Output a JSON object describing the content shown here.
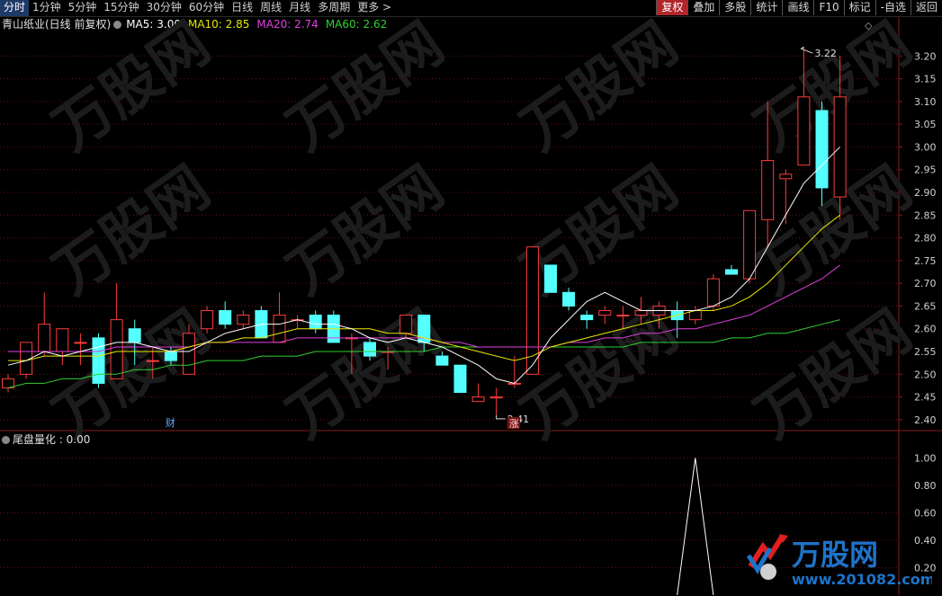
{
  "toolbar": {
    "left": [
      "分时",
      "1分钟",
      "5分钟",
      "15分钟",
      "30分钟",
      "60分钟",
      "日线",
      "周线",
      "月线",
      "多周期",
      "更多 >"
    ],
    "right": [
      "复权",
      "叠加",
      "多股",
      "统计",
      "画线",
      "F10",
      "标记",
      "-自选",
      "返回"
    ],
    "active_left": 0,
    "active_right": 0
  },
  "info": {
    "stock": "青山纸业(日线 前复权)",
    "ma5": "MA5: 3.00",
    "ma10": "MA10: 2.85",
    "ma20": "MA20: 2.74",
    "ma60": "MA60: 2.62"
  },
  "subchart": {
    "label": "尾盘量化 : 0.00"
  },
  "watermark": {
    "brand": "万股网",
    "url": "www.201082.com"
  },
  "colors": {
    "up": "#ff3c3c",
    "down": "#54ffff",
    "ma5": "#ffffff",
    "ma10": "#e8e800",
    "ma20": "#e040e0",
    "ma60": "#30d030",
    "grid": "#6a1010",
    "axis_text": "#d0d0d0",
    "indicator": "#ffffff"
  },
  "chart_data": {
    "type": "candlestick",
    "title": "",
    "y_ticks": [
      2.4,
      2.45,
      2.5,
      2.55,
      2.6,
      2.65,
      2.7,
      2.75,
      2.8,
      2.85,
      2.9,
      2.95,
      3.0,
      3.05,
      3.1,
      3.15,
      3.2
    ],
    "ylim": [
      2.38,
      3.25
    ],
    "annotations": {
      "high": "3.22",
      "low": "2.41",
      "marker_cai": "财",
      "marker_zhang": "涨"
    },
    "candles": [
      {
        "o": 2.47,
        "h": 2.5,
        "l": 2.46,
        "c": 2.49
      },
      {
        "o": 2.5,
        "h": 2.57,
        "l": 2.49,
        "c": 2.57
      },
      {
        "o": 2.55,
        "h": 2.68,
        "l": 2.54,
        "c": 2.61
      },
      {
        "o": 2.55,
        "h": 2.6,
        "l": 2.52,
        "c": 2.6
      },
      {
        "o": 2.57,
        "h": 2.59,
        "l": 2.52,
        "c": 2.57
      },
      {
        "o": 2.58,
        "h": 2.59,
        "l": 2.47,
        "c": 2.48
      },
      {
        "o": 2.49,
        "h": 2.7,
        "l": 2.49,
        "c": 2.62
      },
      {
        "o": 2.6,
        "h": 2.62,
        "l": 2.52,
        "c": 2.57
      },
      {
        "o": 2.53,
        "h": 2.56,
        "l": 2.49,
        "c": 2.53
      },
      {
        "o": 2.55,
        "h": 2.56,
        "l": 2.52,
        "c": 2.53
      },
      {
        "o": 2.5,
        "h": 2.61,
        "l": 2.5,
        "c": 2.59
      },
      {
        "o": 2.6,
        "h": 2.65,
        "l": 2.59,
        "c": 2.64
      },
      {
        "o": 2.64,
        "h": 2.66,
        "l": 2.6,
        "c": 2.61
      },
      {
        "o": 2.61,
        "h": 2.64,
        "l": 2.6,
        "c": 2.63
      },
      {
        "o": 2.64,
        "h": 2.65,
        "l": 2.59,
        "c": 2.58
      },
      {
        "o": 2.57,
        "h": 2.68,
        "l": 2.57,
        "c": 2.63
      },
      {
        "o": 2.62,
        "h": 2.63,
        "l": 2.6,
        "c": 2.62
      },
      {
        "o": 2.63,
        "h": 2.64,
        "l": 2.59,
        "c": 2.6
      },
      {
        "o": 2.63,
        "h": 2.64,
        "l": 2.57,
        "c": 2.57
      },
      {
        "o": 2.58,
        "h": 2.59,
        "l": 2.5,
        "c": 2.58
      },
      {
        "o": 2.57,
        "h": 2.58,
        "l": 2.53,
        "c": 2.54
      },
      {
        "o": 2.55,
        "h": 2.56,
        "l": 2.51,
        "c": 2.55
      },
      {
        "o": 2.59,
        "h": 2.63,
        "l": 2.58,
        "c": 2.63
      },
      {
        "o": 2.63,
        "h": 2.63,
        "l": 2.55,
        "c": 2.57
      },
      {
        "o": 2.54,
        "h": 2.55,
        "l": 2.52,
        "c": 2.52
      },
      {
        "o": 2.52,
        "h": 2.52,
        "l": 2.46,
        "c": 2.46
      },
      {
        "o": 2.44,
        "h": 2.48,
        "l": 2.44,
        "c": 2.45
      },
      {
        "o": 2.45,
        "h": 2.47,
        "l": 2.41,
        "c": 2.45
      },
      {
        "o": 2.48,
        "h": 2.54,
        "l": 2.47,
        "c": 2.48
      },
      {
        "o": 2.5,
        "h": 2.78,
        "l": 2.5,
        "c": 2.78
      },
      {
        "o": 2.74,
        "h": 2.74,
        "l": 2.68,
        "c": 2.68
      },
      {
        "o": 2.68,
        "h": 2.69,
        "l": 2.64,
        "c": 2.65
      },
      {
        "o": 2.63,
        "h": 2.64,
        "l": 2.6,
        "c": 2.62
      },
      {
        "o": 2.63,
        "h": 2.65,
        "l": 2.61,
        "c": 2.64
      },
      {
        "o": 2.63,
        "h": 2.65,
        "l": 2.6,
        "c": 2.63
      },
      {
        "o": 2.63,
        "h": 2.67,
        "l": 2.61,
        "c": 2.64
      },
      {
        "o": 2.63,
        "h": 2.66,
        "l": 2.6,
        "c": 2.65
      },
      {
        "o": 2.64,
        "h": 2.66,
        "l": 2.58,
        "c": 2.62
      },
      {
        "o": 2.62,
        "h": 2.65,
        "l": 2.61,
        "c": 2.64
      },
      {
        "o": 2.65,
        "h": 2.72,
        "l": 2.64,
        "c": 2.71
      },
      {
        "o": 2.73,
        "h": 2.74,
        "l": 2.72,
        "c": 2.72
      },
      {
        "o": 2.71,
        "h": 2.85,
        "l": 2.7,
        "c": 2.86
      },
      {
        "o": 2.84,
        "h": 3.1,
        "l": 2.78,
        "c": 2.97
      },
      {
        "o": 2.93,
        "h": 2.95,
        "l": 2.83,
        "c": 2.94
      },
      {
        "o": 2.96,
        "h": 3.22,
        "l": 2.96,
        "c": 3.11
      },
      {
        "o": 3.08,
        "h": 3.1,
        "l": 2.87,
        "c": 2.91
      },
      {
        "o": 2.89,
        "h": 3.2,
        "l": 2.84,
        "c": 3.11
      }
    ],
    "ma5": [
      2.52,
      2.53,
      2.55,
      2.54,
      2.55,
      2.56,
      2.57,
      2.57,
      2.56,
      2.55,
      2.55,
      2.57,
      2.59,
      2.6,
      2.61,
      2.61,
      2.62,
      2.61,
      2.61,
      2.6,
      2.58,
      2.57,
      2.58,
      2.57,
      2.56,
      2.54,
      2.52,
      2.49,
      2.48,
      2.52,
      2.58,
      2.62,
      2.66,
      2.68,
      2.66,
      2.64,
      2.64,
      2.64,
      2.64,
      2.65,
      2.67,
      2.71,
      2.78,
      2.85,
      2.92,
      2.96,
      3.0
    ],
    "ma10": [
      2.53,
      2.53,
      2.54,
      2.54,
      2.54,
      2.54,
      2.55,
      2.55,
      2.55,
      2.55,
      2.56,
      2.57,
      2.57,
      2.58,
      2.58,
      2.59,
      2.6,
      2.6,
      2.6,
      2.6,
      2.6,
      2.59,
      2.59,
      2.58,
      2.57,
      2.56,
      2.55,
      2.54,
      2.53,
      2.54,
      2.56,
      2.57,
      2.58,
      2.59,
      2.6,
      2.61,
      2.62,
      2.63,
      2.64,
      2.64,
      2.65,
      2.67,
      2.7,
      2.74,
      2.78,
      2.82,
      2.85
    ],
    "ma20": [
      2.55,
      2.55,
      2.55,
      2.55,
      2.55,
      2.55,
      2.56,
      2.56,
      2.56,
      2.56,
      2.56,
      2.57,
      2.57,
      2.57,
      2.57,
      2.57,
      2.58,
      2.58,
      2.58,
      2.58,
      2.58,
      2.58,
      2.58,
      2.58,
      2.57,
      2.57,
      2.56,
      2.56,
      2.56,
      2.56,
      2.56,
      2.57,
      2.57,
      2.58,
      2.58,
      2.59,
      2.59,
      2.6,
      2.6,
      2.61,
      2.62,
      2.63,
      2.65,
      2.67,
      2.69,
      2.71,
      2.74
    ],
    "ma60": [
      2.47,
      2.48,
      2.48,
      2.49,
      2.49,
      2.5,
      2.5,
      2.51,
      2.51,
      2.52,
      2.52,
      2.53,
      2.53,
      2.53,
      2.54,
      2.54,
      2.54,
      2.55,
      2.55,
      2.55,
      2.55,
      2.55,
      2.55,
      2.55,
      2.56,
      2.56,
      2.56,
      2.56,
      2.56,
      2.56,
      2.56,
      2.56,
      2.56,
      2.56,
      2.56,
      2.57,
      2.57,
      2.57,
      2.57,
      2.57,
      2.58,
      2.58,
      2.59,
      2.59,
      2.6,
      2.61,
      2.62
    ],
    "indicator": {
      "name": "尾盘量化",
      "y_ticks": [
        0.2,
        0.4,
        0.6,
        0.8,
        1.0
      ],
      "ylim": [
        0,
        1.2
      ],
      "spike_index": 38,
      "spike_value": 1.0
    }
  }
}
